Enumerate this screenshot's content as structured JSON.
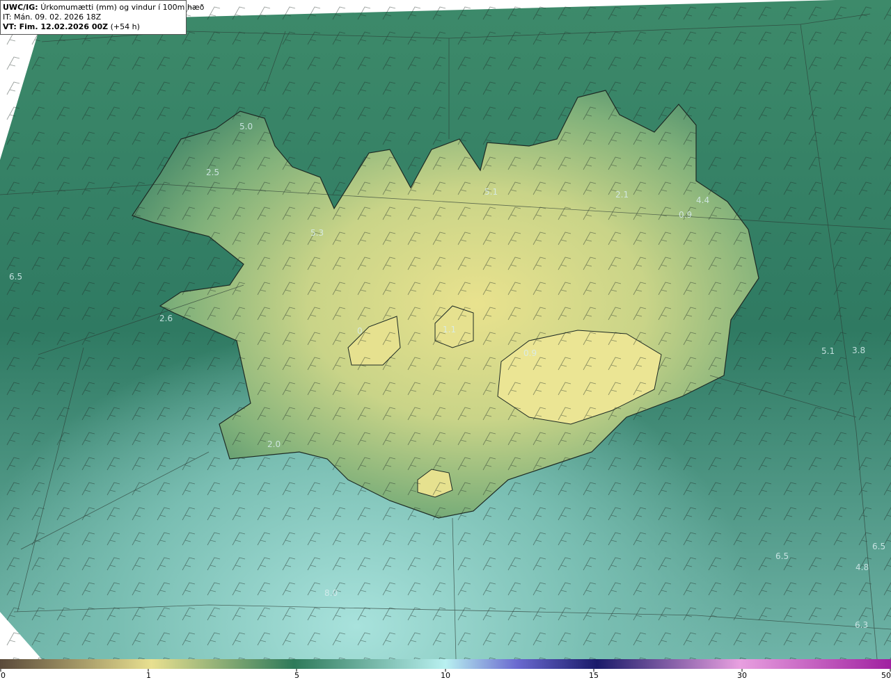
{
  "header": {
    "model": "UWC/IG:",
    "title": "Úrkomumætti (mm) og vindur í 100m hæð",
    "init_prefix": "IT:",
    "init_time": "Mán. 09. 02. 2026 18Z",
    "valid_prefix": "VT: Fim. 12.02.2026 00Z",
    "valid_suffix": "(+54 h)"
  },
  "map_labels": [
    {
      "id": "label-vestfirdir-north",
      "text": "5.0"
    },
    {
      "id": "label-vestfirdir",
      "text": "2.5"
    },
    {
      "id": "label-breidafjordur",
      "text": "5.3"
    },
    {
      "id": "label-west-sea",
      "text": "6.5"
    },
    {
      "id": "label-snaefellsnes",
      "text": "2.6"
    },
    {
      "id": "label-north",
      "text": "5.1"
    },
    {
      "id": "label-northeast",
      "text": "2.1"
    },
    {
      "id": "label-east-coast",
      "text": "4.4"
    },
    {
      "id": "label-east",
      "text": "0.9"
    },
    {
      "id": "label-langjokull",
      "text": "0"
    },
    {
      "id": "label-hofsjokull",
      "text": "1.1"
    },
    {
      "id": "label-vatnajokull",
      "text": "0.9"
    },
    {
      "id": "label-reykjanes",
      "text": "2.0"
    },
    {
      "id": "label-east-sea-1",
      "text": "5.1"
    },
    {
      "id": "label-east-sea-2",
      "text": "3.8"
    },
    {
      "id": "label-south-sea",
      "text": "8.0"
    },
    {
      "id": "label-se-sea-1",
      "text": "6.5"
    },
    {
      "id": "label-se-sea-2",
      "text": "6.5"
    },
    {
      "id": "label-se-sea-3",
      "text": "4.8"
    },
    {
      "id": "label-se-sea-4",
      "text": "6.3"
    }
  ],
  "colorbar": {
    "ticks": [
      "0",
      "1",
      "5",
      "10",
      "15",
      "30",
      "50"
    ],
    "colors": [
      "#5a4a3a",
      "#b8a878",
      "#e8e090",
      "#2e7a5a",
      "#b8f0f0",
      "#2a2a9a",
      "#1a1a6a",
      "#e8a0e0",
      "#a020a0"
    ]
  }
}
